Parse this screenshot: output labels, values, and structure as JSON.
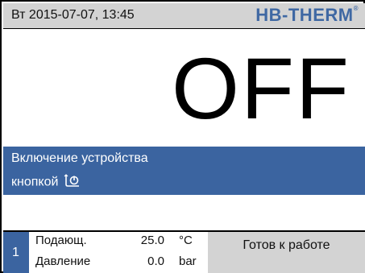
{
  "header": {
    "datetime": "Вт  2015-07-07, 13:45",
    "logo": "HB-THERM",
    "logo_mark": "®"
  },
  "main": {
    "state": "OFF",
    "message_line1": "Включение устройства",
    "message_line2": "кнопкой",
    "message_icon": "power-button-icon"
  },
  "status": {
    "tab_number": "1",
    "rows": [
      {
        "label": "Подающ.",
        "value": "25.0",
        "unit": "°C"
      },
      {
        "label": "Давление",
        "value": "0.0",
        "unit": "bar"
      }
    ],
    "ready_text": "Готов к работе"
  },
  "colors": {
    "header_bg": "#d3d3d3",
    "accent_blue": "#3b64a0",
    "logo_blue": "#3f68a3"
  }
}
